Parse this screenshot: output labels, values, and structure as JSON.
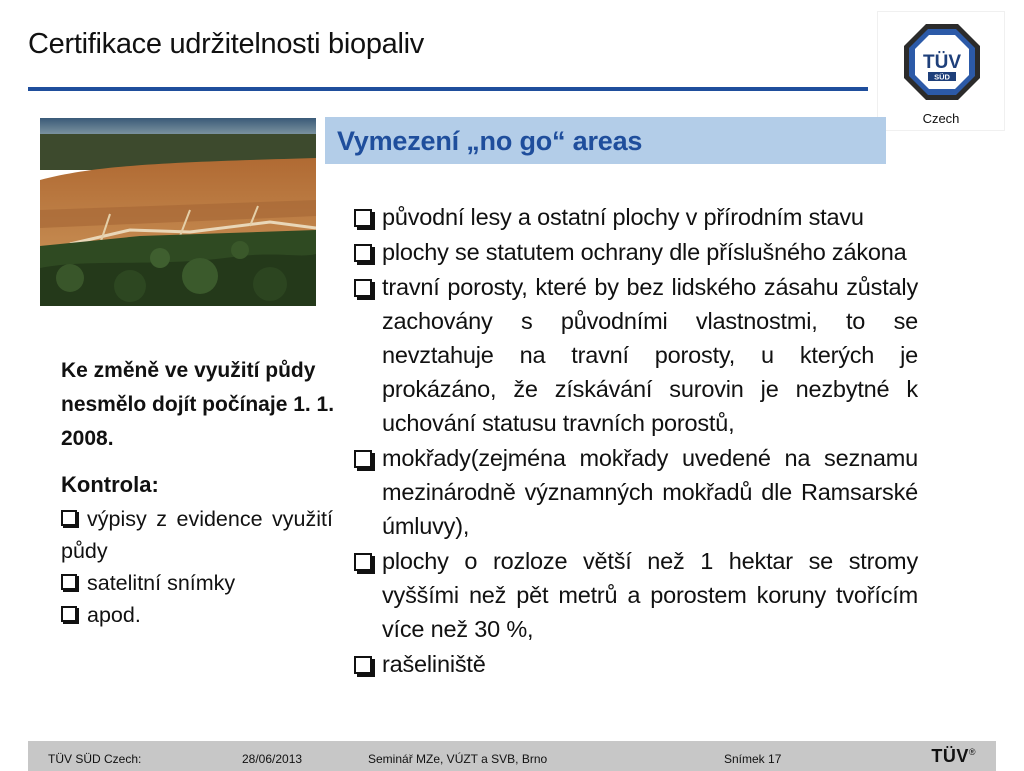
{
  "slide": {
    "title": "Certifikace udržitelnosti biopaliv",
    "heading": "Vymezení „no go“ areas"
  },
  "logo": {
    "text": "TÜV",
    "subtext": "SÜD",
    "caption": "Czech",
    "colors": {
      "blue": "#2c5aa8",
      "dark": "#2b2b2b"
    }
  },
  "bullets": [
    "původní lesy a ostatní plochy v přírodním stavu",
    "plochy se statutem ochrany dle příslušného zákona",
    "travní porosty, které by bez lidského zásahu zůstaly zachovány s původními vlastnostmi, to se nevztahuje na travní porosty, u kterých je prokázáno, že získávání surovin je nezbytné k uchování statusu travních porostů,",
    "mokřady(zejména mokřady uvedené na seznamu mezinárodně významných mokřadů dle Ramsarské úmluvy),",
    "plochy o rozloze větší než 1 hektar se stromy vyššími než pět metrů a porostem koruny tvořícím více než 30 %,",
    "rašeliniště"
  ],
  "side": {
    "note": "Ke změně ve využití půdy nesmělo dojít počínaje 1. 1. 2008.",
    "kontrola_label": "Kontrola:",
    "items": [
      "výpisy z evidence využití půdy",
      "satelitní snímky",
      "apod."
    ]
  },
  "footer": {
    "org": "TÜV SÜD Czech:",
    "date": "28/06/2013",
    "event": "Seminář  MZe, VÚZT a SVB, Brno",
    "slide_no": "Snímek 17",
    "logo": "TÜV",
    "reg": "®"
  },
  "colors": {
    "accent": "#1f4e9c",
    "heading_band": "#b3cde8",
    "footer_bg": "#c7c7c7"
  }
}
